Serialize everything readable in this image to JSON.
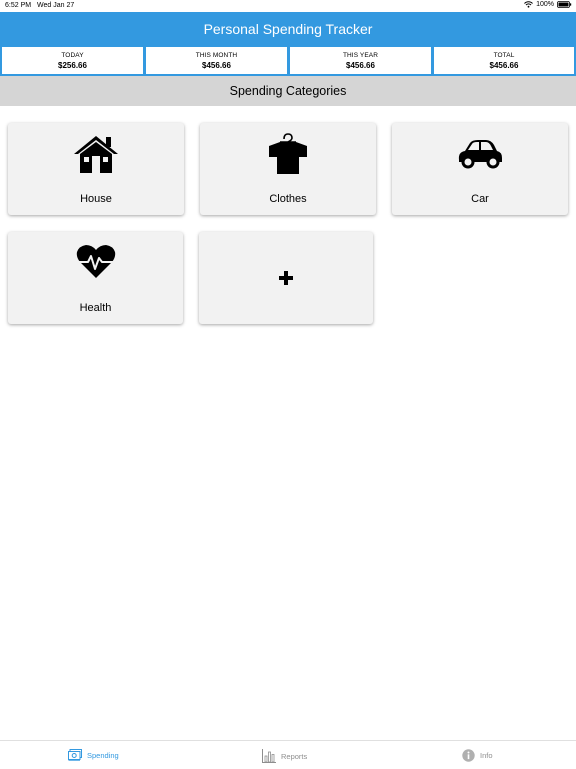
{
  "status_bar": {
    "time": "6:52 PM",
    "date": "Wed Jan 27",
    "battery": "100%"
  },
  "header": {
    "title": "Personal Spending Tracker"
  },
  "summary": [
    {
      "label": "TODAY",
      "value": "$256.66"
    },
    {
      "label": "THIS MONTH",
      "value": "$456.66"
    },
    {
      "label": "THIS YEAR",
      "value": "$456.66"
    },
    {
      "label": "TOTAL",
      "value": "$456.66"
    }
  ],
  "section": {
    "title": "Spending Categories"
  },
  "categories": [
    {
      "label": "House",
      "icon": "house-icon"
    },
    {
      "label": "Clothes",
      "icon": "shirt-icon"
    },
    {
      "label": "Car",
      "icon": "car-icon"
    },
    {
      "label": "Health",
      "icon": "heartbeat-icon"
    },
    {
      "label": "",
      "icon": "plus-icon"
    }
  ],
  "tabs": [
    {
      "label": "Spending",
      "icon": "money-icon",
      "active": true
    },
    {
      "label": "Reports",
      "icon": "bar-chart-icon",
      "active": false
    },
    {
      "label": "Info",
      "icon": "info-icon",
      "active": false
    }
  ],
  "colors": {
    "header": "#3399e0",
    "section_bar": "#d5d5d5",
    "card": "#f2f2f2",
    "active_tab": "#3399e0"
  }
}
